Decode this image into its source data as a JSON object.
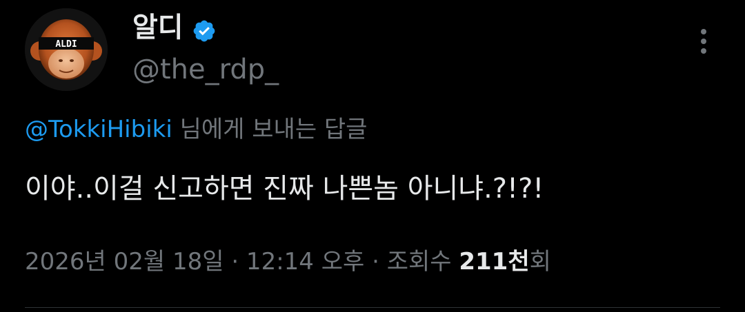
{
  "author": {
    "display_name": "알디",
    "handle": "@the_rdp_",
    "verified": true,
    "avatar_caption": "ALDI"
  },
  "reply": {
    "mention": "@TokkiHibiki",
    "suffix": "님에게 보내는 답글"
  },
  "tweet": {
    "text": "이야..이걸 신고하면 진짜 나쁜놈 아니냐.?!?!"
  },
  "meta": {
    "timestamp": "2026년 02월 18일 · 12:14 오후 · 조회수 ",
    "views_number": "211천",
    "views_suffix": "회"
  },
  "colors": {
    "background": "#000000",
    "primary_text": "#e7e9ea",
    "secondary_text": "#71767b",
    "accent_blue": "#1d9bf0",
    "divider": "#2f3336"
  },
  "icons": {
    "verified": "verified-badge-icon",
    "more": "more-vertical-icon"
  }
}
